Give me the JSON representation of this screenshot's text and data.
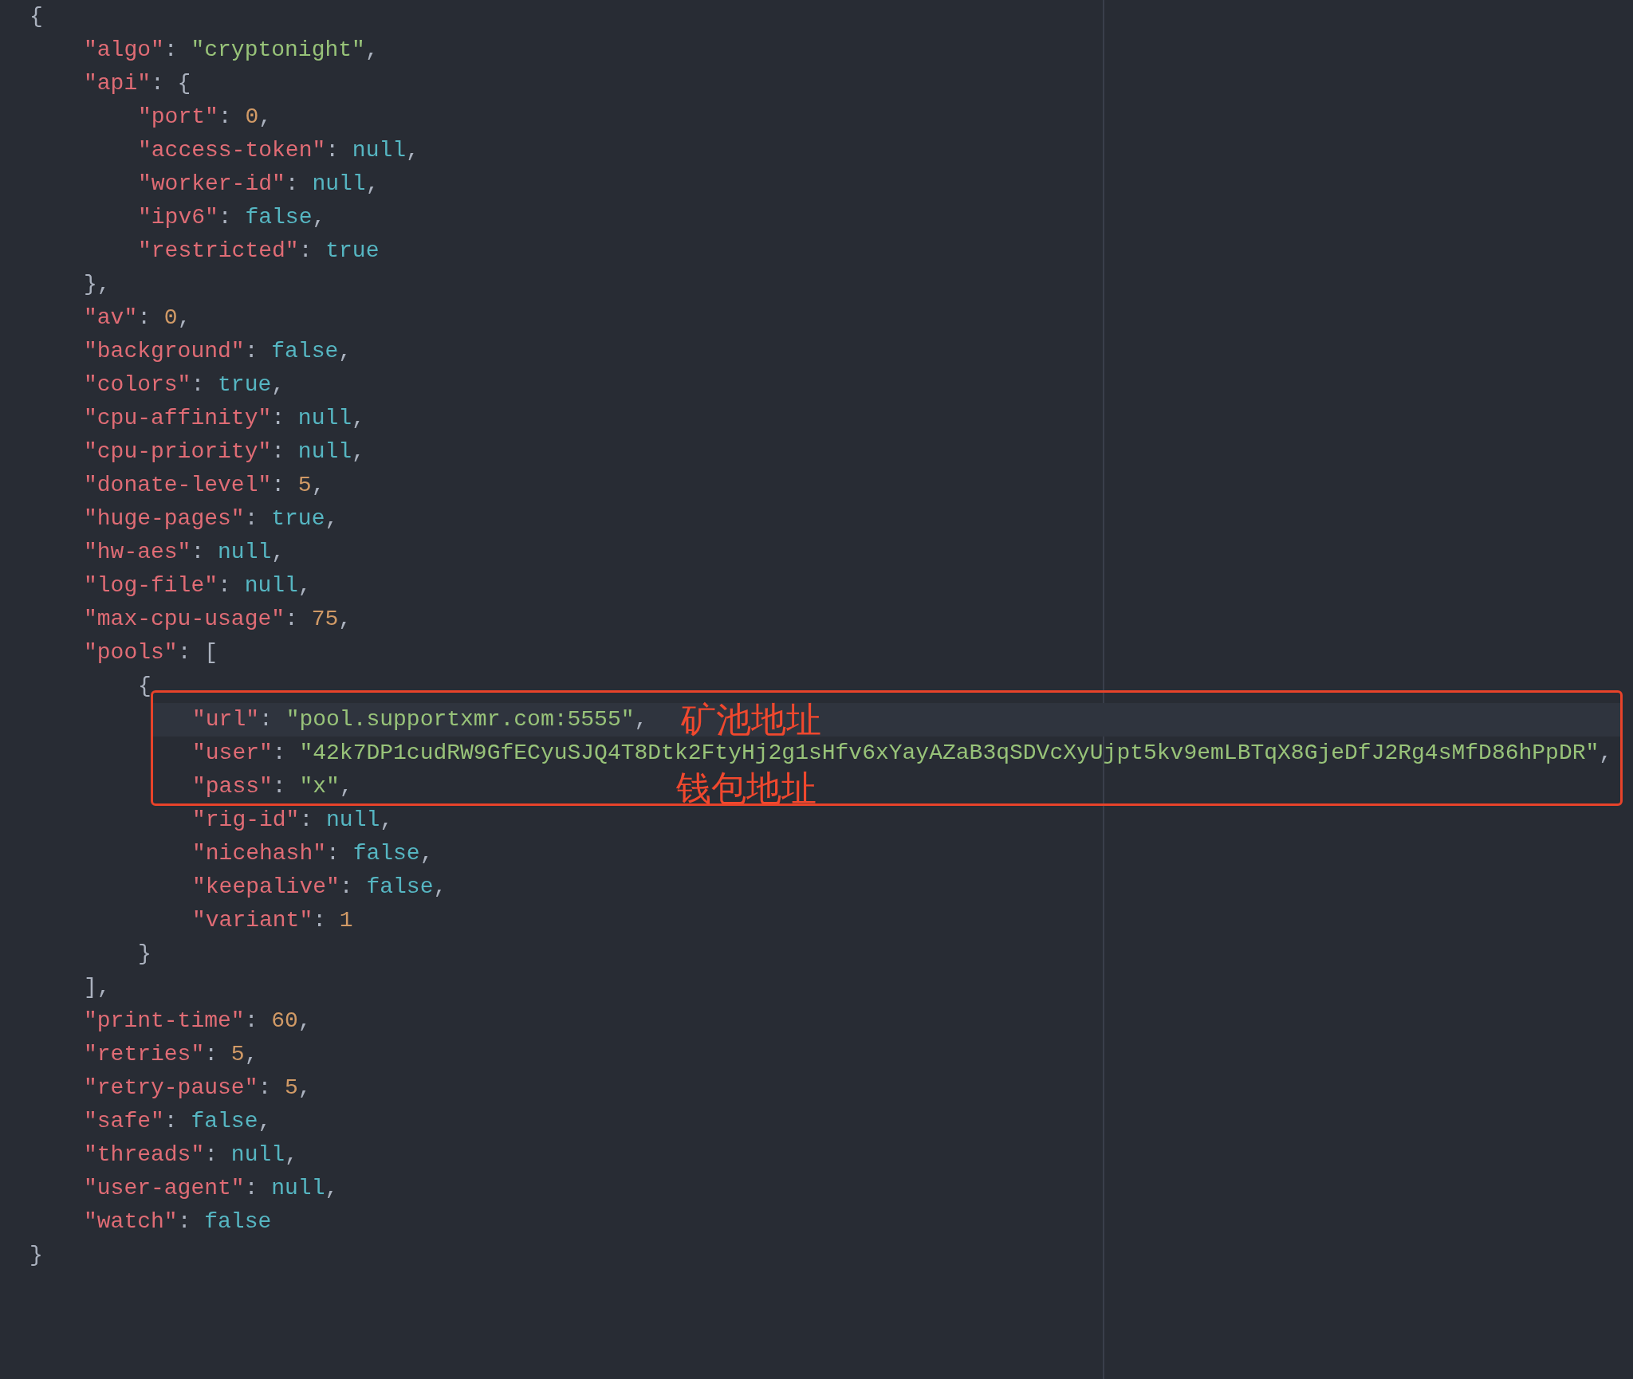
{
  "code": {
    "lines": [
      {
        "tokens": [
          {
            "kind": "punct",
            "text": "{"
          }
        ],
        "current": false,
        "boxed": false,
        "close": "}",
        "children": [
          {
            "tokens": [
              {
                "kind": "key",
                "text": "\"algo\""
              },
              {
                "kind": "punct",
                "text": ": "
              },
              {
                "kind": "string",
                "text": "\"cryptonight\""
              },
              {
                "kind": "punct",
                "text": ","
              }
            ],
            "current": false,
            "boxed": false
          },
          {
            "tokens": [
              {
                "kind": "key",
                "text": "\"api\""
              },
              {
                "kind": "punct",
                "text": ": {"
              }
            ],
            "current": false,
            "boxed": false,
            "close": "},",
            "children": [
              {
                "tokens": [
                  {
                    "kind": "key",
                    "text": "\"port\""
                  },
                  {
                    "kind": "punct",
                    "text": ": "
                  },
                  {
                    "kind": "number",
                    "text": "0"
                  },
                  {
                    "kind": "punct",
                    "text": ","
                  }
                ],
                "current": false,
                "boxed": false
              },
              {
                "tokens": [
                  {
                    "kind": "key",
                    "text": "\"access-token\""
                  },
                  {
                    "kind": "punct",
                    "text": ": "
                  },
                  {
                    "kind": "literal",
                    "text": "null"
                  },
                  {
                    "kind": "punct",
                    "text": ","
                  }
                ],
                "current": false,
                "boxed": false
              },
              {
                "tokens": [
                  {
                    "kind": "key",
                    "text": "\"worker-id\""
                  },
                  {
                    "kind": "punct",
                    "text": ": "
                  },
                  {
                    "kind": "literal",
                    "text": "null"
                  },
                  {
                    "kind": "punct",
                    "text": ","
                  }
                ],
                "current": false,
                "boxed": false
              },
              {
                "tokens": [
                  {
                    "kind": "key",
                    "text": "\"ipv6\""
                  },
                  {
                    "kind": "punct",
                    "text": ": "
                  },
                  {
                    "kind": "literal",
                    "text": "false"
                  },
                  {
                    "kind": "punct",
                    "text": ","
                  }
                ],
                "current": false,
                "boxed": false
              },
              {
                "tokens": [
                  {
                    "kind": "key",
                    "text": "\"restricted\""
                  },
                  {
                    "kind": "punct",
                    "text": ": "
                  },
                  {
                    "kind": "literal",
                    "text": "true"
                  }
                ],
                "current": false,
                "boxed": false
              }
            ]
          },
          {
            "tokens": [
              {
                "kind": "key",
                "text": "\"av\""
              },
              {
                "kind": "punct",
                "text": ": "
              },
              {
                "kind": "number",
                "text": "0"
              },
              {
                "kind": "punct",
                "text": ","
              }
            ],
            "current": false,
            "boxed": false
          },
          {
            "tokens": [
              {
                "kind": "key",
                "text": "\"background\""
              },
              {
                "kind": "punct",
                "text": ": "
              },
              {
                "kind": "literal",
                "text": "false"
              },
              {
                "kind": "punct",
                "text": ","
              }
            ],
            "current": false,
            "boxed": false
          },
          {
            "tokens": [
              {
                "kind": "key",
                "text": "\"colors\""
              },
              {
                "kind": "punct",
                "text": ": "
              },
              {
                "kind": "literal",
                "text": "true"
              },
              {
                "kind": "punct",
                "text": ","
              }
            ],
            "current": false,
            "boxed": false
          },
          {
            "tokens": [
              {
                "kind": "key",
                "text": "\"cpu-affinity\""
              },
              {
                "kind": "punct",
                "text": ": "
              },
              {
                "kind": "literal",
                "text": "null"
              },
              {
                "kind": "punct",
                "text": ","
              }
            ],
            "current": false,
            "boxed": false
          },
          {
            "tokens": [
              {
                "kind": "key",
                "text": "\"cpu-priority\""
              },
              {
                "kind": "punct",
                "text": ": "
              },
              {
                "kind": "literal",
                "text": "null"
              },
              {
                "kind": "punct",
                "text": ","
              }
            ],
            "current": false,
            "boxed": false
          },
          {
            "tokens": [
              {
                "kind": "key",
                "text": "\"donate-level\""
              },
              {
                "kind": "punct",
                "text": ": "
              },
              {
                "kind": "number",
                "text": "5"
              },
              {
                "kind": "punct",
                "text": ","
              }
            ],
            "current": false,
            "boxed": false
          },
          {
            "tokens": [
              {
                "kind": "key",
                "text": "\"huge-pages\""
              },
              {
                "kind": "punct",
                "text": ": "
              },
              {
                "kind": "literal",
                "text": "true"
              },
              {
                "kind": "punct",
                "text": ","
              }
            ],
            "current": false,
            "boxed": false
          },
          {
            "tokens": [
              {
                "kind": "key",
                "text": "\"hw-aes\""
              },
              {
                "kind": "punct",
                "text": ": "
              },
              {
                "kind": "literal",
                "text": "null"
              },
              {
                "kind": "punct",
                "text": ","
              }
            ],
            "current": false,
            "boxed": false
          },
          {
            "tokens": [
              {
                "kind": "key",
                "text": "\"log-file\""
              },
              {
                "kind": "punct",
                "text": ": "
              },
              {
                "kind": "literal",
                "text": "null"
              },
              {
                "kind": "punct",
                "text": ","
              }
            ],
            "current": false,
            "boxed": false
          },
          {
            "tokens": [
              {
                "kind": "key",
                "text": "\"max-cpu-usage\""
              },
              {
                "kind": "punct",
                "text": ": "
              },
              {
                "kind": "number",
                "text": "75"
              },
              {
                "kind": "punct",
                "text": ","
              }
            ],
            "current": false,
            "boxed": false
          },
          {
            "tokens": [
              {
                "kind": "key",
                "text": "\"pools\""
              },
              {
                "kind": "punct",
                "text": ": ["
              }
            ],
            "current": false,
            "boxed": false,
            "close": "],",
            "children": [
              {
                "tokens": [
                  {
                    "kind": "punct",
                    "text": "{"
                  }
                ],
                "current": false,
                "boxed": false,
                "close": "}",
                "children": [
                  {
                    "tokens": [
                      {
                        "kind": "key",
                        "text": "\"url\""
                      },
                      {
                        "kind": "punct",
                        "text": ": "
                      },
                      {
                        "kind": "string",
                        "text": "\"pool.supportxmr.com:5555\""
                      },
                      {
                        "kind": "punct",
                        "text": ","
                      }
                    ],
                    "current": true,
                    "boxed": true
                  },
                  {
                    "tokens": [
                      {
                        "kind": "key",
                        "text": "\"user\""
                      },
                      {
                        "kind": "punct",
                        "text": ": "
                      },
                      {
                        "kind": "string",
                        "text": "\"42k7DP1cudRW9GfECyuSJQ4T8Dtk2FtyHj2g1sHfv6xYayAZaB3qSDVcXyUjpt5kv9emLBTqX8GjeDfJ2Rg4sMfD86hPpDR\""
                      },
                      {
                        "kind": "punct",
                        "text": ","
                      }
                    ],
                    "current": false,
                    "boxed": true
                  },
                  {
                    "tokens": [
                      {
                        "kind": "key",
                        "text": "\"pass\""
                      },
                      {
                        "kind": "punct",
                        "text": ": "
                      },
                      {
                        "kind": "string",
                        "text": "\"x\""
                      },
                      {
                        "kind": "punct",
                        "text": ","
                      }
                    ],
                    "current": false,
                    "boxed": true
                  },
                  {
                    "tokens": [
                      {
                        "kind": "key",
                        "text": "\"rig-id\""
                      },
                      {
                        "kind": "punct",
                        "text": ": "
                      },
                      {
                        "kind": "literal",
                        "text": "null"
                      },
                      {
                        "kind": "punct",
                        "text": ","
                      }
                    ],
                    "current": false,
                    "boxed": false
                  },
                  {
                    "tokens": [
                      {
                        "kind": "key",
                        "text": "\"nicehash\""
                      },
                      {
                        "kind": "punct",
                        "text": ": "
                      },
                      {
                        "kind": "literal",
                        "text": "false"
                      },
                      {
                        "kind": "punct",
                        "text": ","
                      }
                    ],
                    "current": false,
                    "boxed": false
                  },
                  {
                    "tokens": [
                      {
                        "kind": "key",
                        "text": "\"keepalive\""
                      },
                      {
                        "kind": "punct",
                        "text": ": "
                      },
                      {
                        "kind": "literal",
                        "text": "false"
                      },
                      {
                        "kind": "punct",
                        "text": ","
                      }
                    ],
                    "current": false,
                    "boxed": false
                  },
                  {
                    "tokens": [
                      {
                        "kind": "key",
                        "text": "\"variant\""
                      },
                      {
                        "kind": "punct",
                        "text": ": "
                      },
                      {
                        "kind": "number",
                        "text": "1"
                      }
                    ],
                    "current": false,
                    "boxed": false
                  }
                ]
              }
            ]
          },
          {
            "tokens": [
              {
                "kind": "key",
                "text": "\"print-time\""
              },
              {
                "kind": "punct",
                "text": ": "
              },
              {
                "kind": "number",
                "text": "60"
              },
              {
                "kind": "punct",
                "text": ","
              }
            ],
            "current": false,
            "boxed": false
          },
          {
            "tokens": [
              {
                "kind": "key",
                "text": "\"retries\""
              },
              {
                "kind": "punct",
                "text": ": "
              },
              {
                "kind": "number",
                "text": "5"
              },
              {
                "kind": "punct",
                "text": ","
              }
            ],
            "current": false,
            "boxed": false
          },
          {
            "tokens": [
              {
                "kind": "key",
                "text": "\"retry-pause\""
              },
              {
                "kind": "punct",
                "text": ": "
              },
              {
                "kind": "number",
                "text": "5"
              },
              {
                "kind": "punct",
                "text": ","
              }
            ],
            "current": false,
            "boxed": false
          },
          {
            "tokens": [
              {
                "kind": "key",
                "text": "\"safe\""
              },
              {
                "kind": "punct",
                "text": ": "
              },
              {
                "kind": "literal",
                "text": "false"
              },
              {
                "kind": "punct",
                "text": ","
              }
            ],
            "current": false,
            "boxed": false
          },
          {
            "tokens": [
              {
                "kind": "key",
                "text": "\"threads\""
              },
              {
                "kind": "punct",
                "text": ": "
              },
              {
                "kind": "literal",
                "text": "null"
              },
              {
                "kind": "punct",
                "text": ","
              }
            ],
            "current": false,
            "boxed": false
          },
          {
            "tokens": [
              {
                "kind": "key",
                "text": "\"user-agent\""
              },
              {
                "kind": "punct",
                "text": ": "
              },
              {
                "kind": "literal",
                "text": "null"
              },
              {
                "kind": "punct",
                "text": ","
              }
            ],
            "current": false,
            "boxed": false
          },
          {
            "tokens": [
              {
                "kind": "key",
                "text": "\"watch\""
              },
              {
                "kind": "punct",
                "text": ": "
              },
              {
                "kind": "literal",
                "text": "false"
              }
            ],
            "current": false,
            "boxed": false
          }
        ]
      }
    ]
  },
  "annotation": {
    "labels": [
      "矿池地址",
      "钱包地址"
    ]
  }
}
